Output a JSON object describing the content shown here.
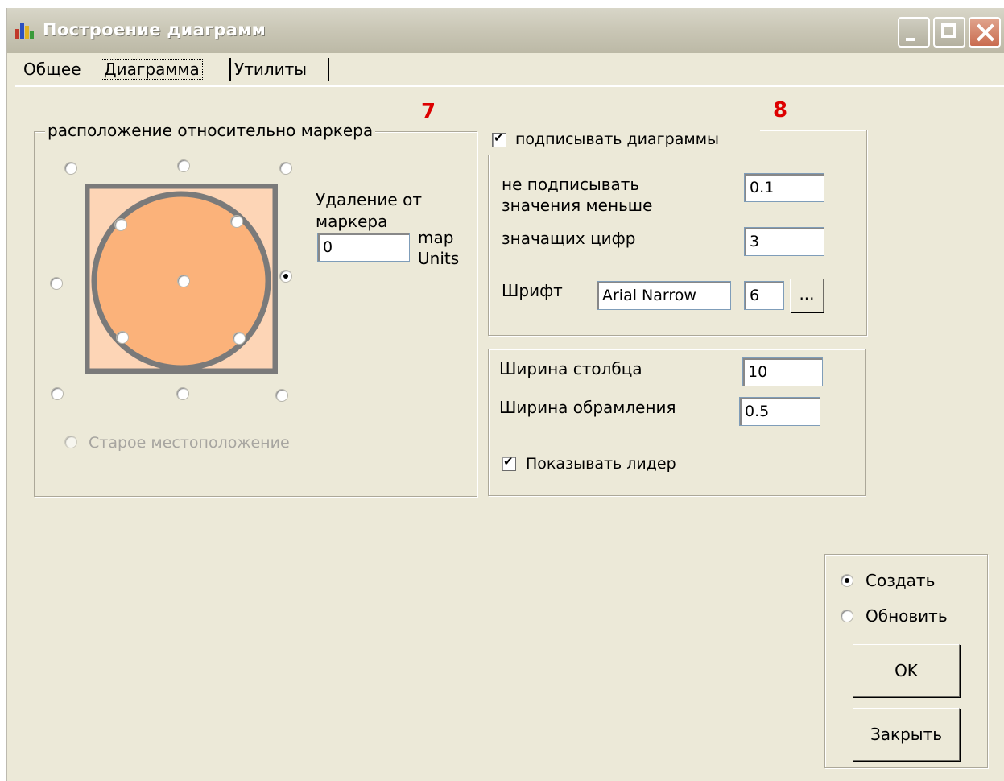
{
  "window": {
    "title": "Построение диаграмм"
  },
  "tabs": [
    {
      "label": "Общее"
    },
    {
      "label": "Диаграмма"
    },
    {
      "label": "Утилиты"
    }
  ],
  "annotations": {
    "seven": "7",
    "eight": "8"
  },
  "placement": {
    "group_label": "расположение относительно маркера",
    "selected_position": "right",
    "distance_label": "Удаление от маркера",
    "distance_value": "0",
    "units_label": "map Units",
    "old_location_label": "Старое местоположение"
  },
  "labels": {
    "sign_checkbox_label": "подписывать диаграммы",
    "sign_checked": true,
    "min_value_label": "не подписывать значения меньше",
    "min_value": "0.1",
    "digits_label": "значащих цифр",
    "digits_value": "3",
    "font_label": "Шрифт",
    "font_name": "Arial Narrow",
    "font_size": "6",
    "font_button": "..."
  },
  "bars": {
    "column_width_label": "Ширина столбца",
    "column_width_value": "10",
    "border_width_label": "Ширина обрамления",
    "border_width_value": "0.5",
    "leader_label": "Показывать лидер",
    "leader_checked": true
  },
  "actions": {
    "create_label": "Создать",
    "update_label": "Обновить",
    "selected": "create",
    "ok_label": "OK",
    "close_label": "Закрыть"
  },
  "colors": {
    "chart_fill": "#fbb27a",
    "chart_bg": "#fdd5b6",
    "chart_frame": "#7a7a7a",
    "annotation_red": "#dd0000"
  }
}
